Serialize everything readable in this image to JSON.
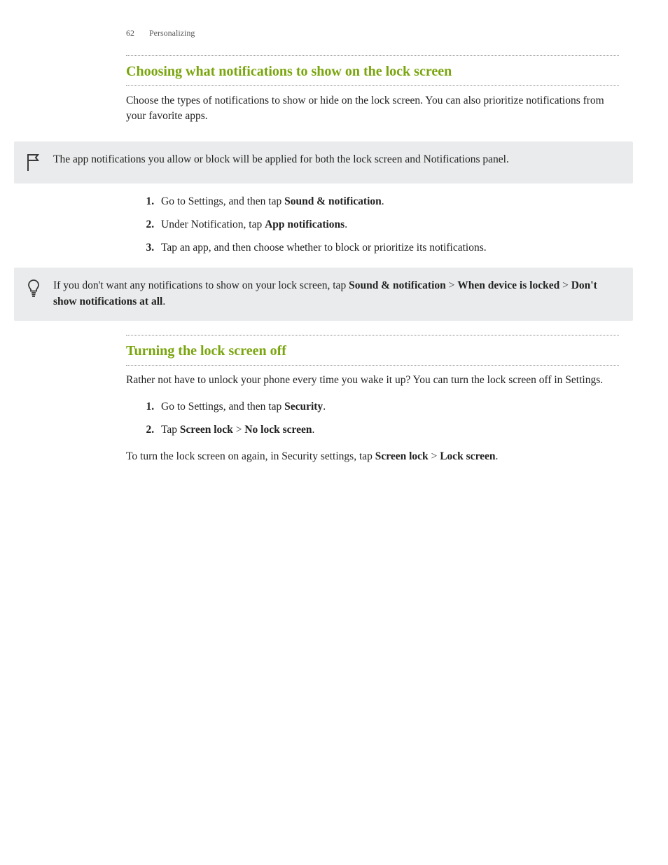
{
  "header": {
    "page_number": "62",
    "chapter": "Personalizing"
  },
  "section1": {
    "title": "Choosing what notifications to show on the lock screen",
    "intro": "Choose the types of notifications to show or hide on the lock screen. You can also prioritize notifications from your favorite apps.",
    "note": "The app notifications you allow or block will be applied for both the lock screen and Notifications panel.",
    "steps": {
      "s1_pre": "Go to Settings, and then tap ",
      "s1_b1": "Sound & notification",
      "s1_post": ".",
      "s2_pre": "Under Notification, tap ",
      "s2_b1": "App notifications",
      "s2_post": ".",
      "s3": "Tap an app, and then choose whether to block or prioritize its notifications."
    },
    "tip": {
      "pre": "If you don't want any notifications to show on your lock screen, tap ",
      "b1": "Sound & notification",
      "sep1": " > ",
      "b2": "When device is locked",
      "sep2": " > ",
      "b3": "Don't show notifications at all",
      "post": "."
    }
  },
  "section2": {
    "title": "Turning the lock screen off",
    "intro": "Rather not have to unlock your phone every time you wake it up? You can turn the lock screen off in Settings.",
    "steps": {
      "s1_pre": "Go to Settings, and then tap ",
      "s1_b1": "Security",
      "s1_post": ".",
      "s2_pre": "Tap ",
      "s2_b1": "Screen lock",
      "s2_sep": " > ",
      "s2_b2": "No lock screen",
      "s2_post": "."
    },
    "outro": {
      "pre": "To turn the lock screen on again, in Security settings, tap ",
      "b1": "Screen lock",
      "sep": " > ",
      "b2": "Lock screen",
      "post": "."
    }
  }
}
